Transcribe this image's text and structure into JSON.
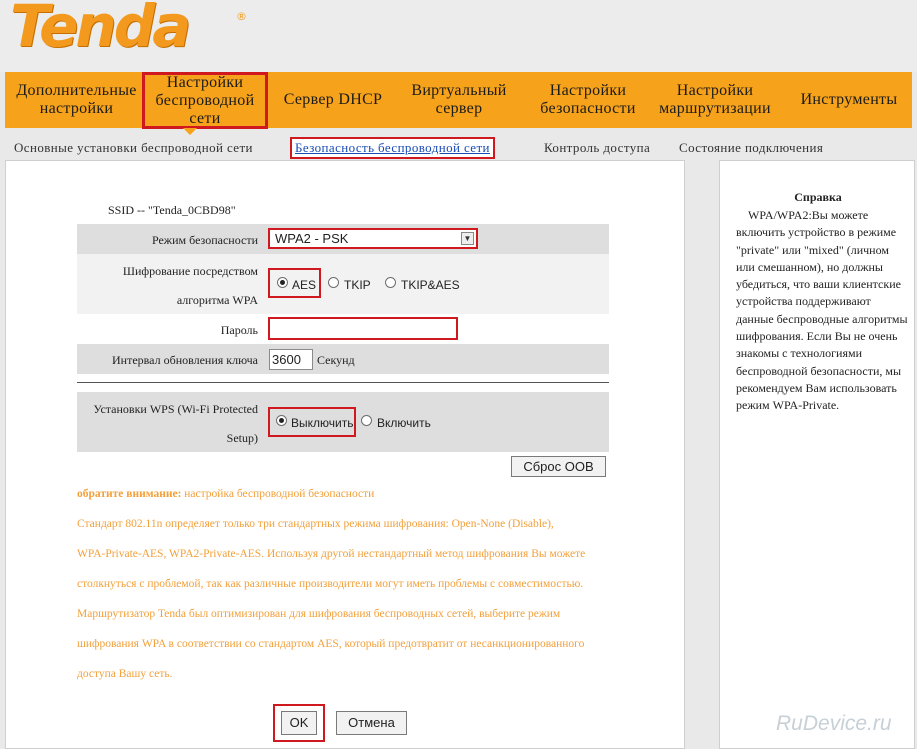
{
  "brand": {
    "logo_text": "Tenda",
    "registered_mark": "®"
  },
  "nav": {
    "items": [
      {
        "label_line1": "Дополнительные",
        "label_line2": "настройки"
      },
      {
        "label_line1": "Настройки",
        "label_line2": "беспроводной",
        "label_line3": "сети",
        "active": true
      },
      {
        "label_line1": "Сервер DHCP"
      },
      {
        "label_line1": "Виртуальный",
        "label_line2": "сервер"
      },
      {
        "label_line1": "Настройки",
        "label_line2": "безопасности"
      },
      {
        "label_line1": "Настройки",
        "label_line2": "маршрутизации"
      },
      {
        "label_line1": "Инструменты"
      }
    ]
  },
  "subnav": {
    "items": [
      {
        "label": "Основные установки беспроводной сети"
      },
      {
        "label": "Безопасность беспроводной сети",
        "active": true
      },
      {
        "label": "Контроль доступа"
      },
      {
        "label": "Состояние подключения"
      }
    ]
  },
  "form": {
    "ssid_text": "SSID -- \"Tenda_0CBD98\"",
    "security_mode_label": "Режим безопасности",
    "security_mode_value": "WPA2 - PSK",
    "encryption_label_line1": "Шифрование посредством",
    "encryption_label_line2": "алгоритма WPA",
    "encryption_options": [
      "AES",
      "TKIP",
      "TKIP&AES"
    ],
    "encryption_selected": "AES",
    "password_label": "Пароль",
    "password_value": "",
    "rekey_label": "Интервал обновления ключа",
    "rekey_value": "3600",
    "rekey_unit": "Секунд",
    "wps_label_line1": "Установки WPS (Wi-Fi Protected",
    "wps_label_line2": "Setup)",
    "wps_options": [
      "Выключить",
      "Включить"
    ],
    "wps_selected": "Выключить",
    "reset_oob_label": "Сброс OOB"
  },
  "note": {
    "heading": "обратите внимание:",
    "heading_rest": " настройка беспроводной безопасности",
    "lines": [
      "Стандарт 802.11n определяет только три стандартных режима шифрования: Open-None (Disable),",
      "WPA-Private-AES, WPA2-Private-AES. Используя другой нестандартный метод шифрования Вы можете",
      "столкнуться с проблемой, так как различные производители могут иметь проблемы с совместимостью.",
      "Маршрутизатор Tenda был оптимизирован для шифрования беспроводных сетей, выберите режим",
      "шифрования WPA в соответствии со стандартом AES, который предотвратит от несанкционированного",
      "доступа Вашу сеть."
    ]
  },
  "actions": {
    "ok_label": "OK",
    "cancel_label": "Отмена"
  },
  "help": {
    "title": "Справка",
    "text": "WPA/WPA2:Вы можете включить устройство в режиме \"private\" или \"mixed\" (личном или смешанном), но должны убедиться, что ваши клиентские устройства поддерживают данные беспроводные алгоритмы шифрования. Если Вы не очень знакомы с технологиями беспроводной безопасности, мы рекомендуем Вам использовать режим WPA-Private."
  },
  "watermark": "RuDevice.ru",
  "colors": {
    "nav_orange": "#f7a21b",
    "highlight_red": "#d0181f",
    "note_orange": "#f2a03a",
    "active_link_blue": "#1a4db6"
  }
}
